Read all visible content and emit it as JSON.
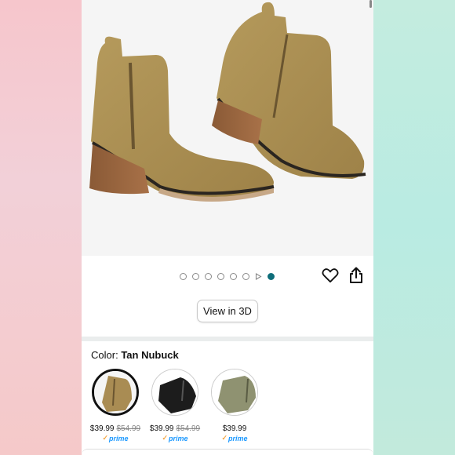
{
  "colors": {
    "accent": "#0f6e7a",
    "prime_blue": "#1a98ff",
    "prime_check": "#f3a847"
  },
  "gallery": {
    "image_name": "tan-nubuck-ankle-boots",
    "dot_count": 7,
    "active_index": 6
  },
  "actions": {
    "view_3d_label": "View in 3D"
  },
  "color_selector": {
    "label": "Color:",
    "selected": "Tan Nubuck",
    "options": [
      {
        "swatch": "tan",
        "price": "$39.99",
        "list_price": "$54.99",
        "prime": "prime",
        "selected": true
      },
      {
        "swatch": "black",
        "price": "$39.99",
        "list_price": "$54.99",
        "prime": "prime",
        "selected": false
      },
      {
        "swatch": "olive",
        "price": "$39.99",
        "list_price": "",
        "prime": "prime",
        "selected": false
      }
    ]
  }
}
